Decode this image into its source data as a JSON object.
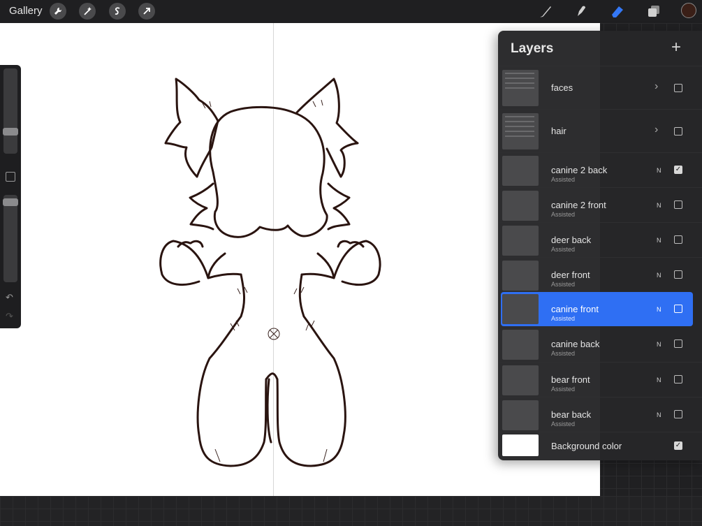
{
  "toolbar": {
    "gallery_label": "Gallery",
    "left_tools": [
      "wrench-icon",
      "magic-wand-icon",
      "selection-icon",
      "transform-arrow-icon"
    ],
    "right_tools": [
      "brush-icon",
      "smudge-icon",
      "eraser-icon",
      "layers-icon"
    ],
    "active_tool": "eraser",
    "color_swatch": "#3a1f17"
  },
  "sidebar": {
    "brush_size": 0.74,
    "opacity": 0.96
  },
  "layers_panel": {
    "title": "Layers",
    "add_label": "+",
    "selected_color": "#2f6ff3",
    "layers": [
      {
        "name": "faces",
        "type": "group",
        "visible": false
      },
      {
        "name": "hair",
        "type": "group",
        "visible": false
      },
      {
        "name": "canine 2 back",
        "sub": "Assisted",
        "blend": "N",
        "visible": true
      },
      {
        "name": "canine 2 front",
        "sub": "Assisted",
        "blend": "N",
        "visible": false
      },
      {
        "name": "deer back",
        "sub": "Assisted",
        "blend": "N",
        "visible": false
      },
      {
        "name": "deer front",
        "sub": "Assisted",
        "blend": "N",
        "visible": false
      },
      {
        "name": "canine front",
        "sub": "Assisted",
        "blend": "N",
        "visible": false,
        "selected": true
      },
      {
        "name": "canine back",
        "sub": "Assisted",
        "blend": "N",
        "visible": false
      },
      {
        "name": "bear front",
        "sub": "Assisted",
        "blend": "N",
        "visible": false
      },
      {
        "name": "bear back",
        "sub": "Assisted",
        "blend": "N",
        "visible": false
      },
      {
        "name": "Background color",
        "type": "background",
        "visible": true
      }
    ]
  }
}
